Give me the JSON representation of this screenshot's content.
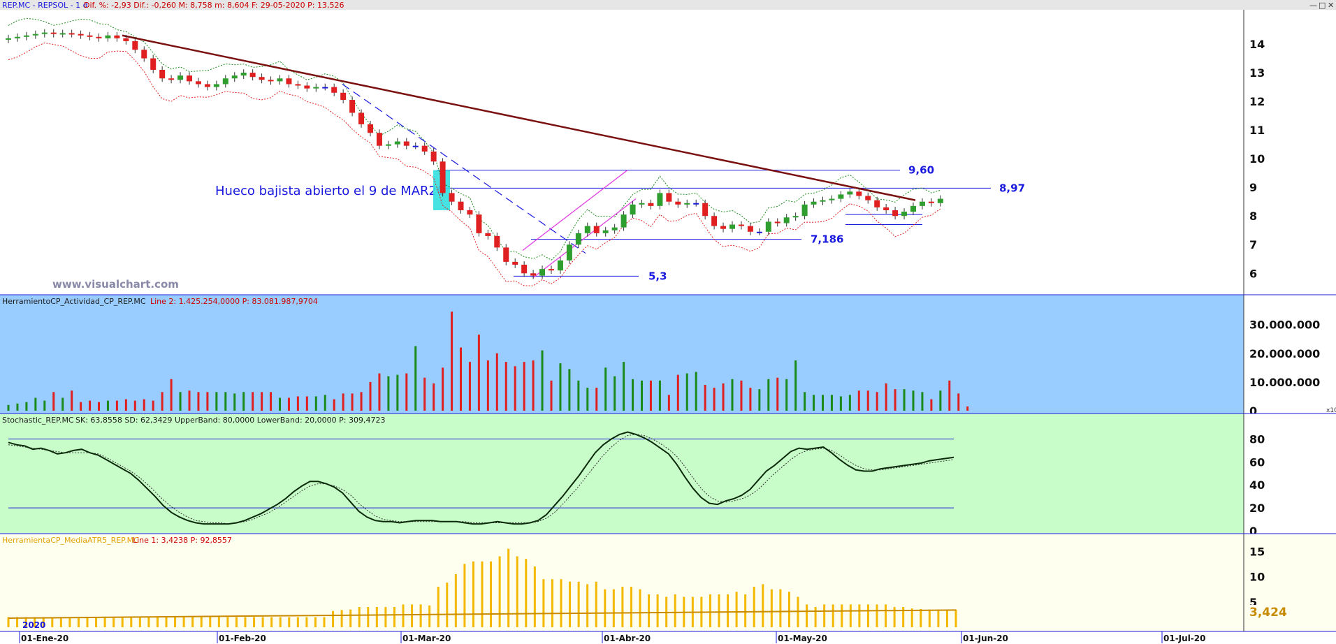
{
  "panels": [
    {
      "id": "price",
      "header": {
        "name": "REP.MC - REPSOL - 1 d",
        "values": "Dif. %: -2,93  Dif.: -0,260  M: 8,758  m: 8,604  F: 29-05-2020  P: 13,526"
      },
      "ylim": [
        5.3,
        15.0
      ],
      "ticks": [
        "14",
        "13",
        "12",
        "11",
        "10",
        "9",
        "8",
        "7",
        "6"
      ],
      "annotation": "Hueco bajista abierto el 9 de MAR20",
      "watermark": "www.visualchart.com",
      "levels": [
        {
          "label": "9,60",
          "value": 9.6
        },
        {
          "label": "8,97",
          "value": 8.97
        },
        {
          "label": "7,186",
          "value": 7.186
        },
        {
          "label": "5,3",
          "value": 5.9
        }
      ]
    },
    {
      "id": "volume",
      "header": {
        "name": "HerramientoCP_Actividad_CP_REP.MC",
        "values": "Line 2: 1.425.254,0000  P: 83.081.987,9704"
      },
      "ticks": [
        "30.000.000",
        "20.000.000",
        "10.000.000",
        "0"
      ],
      "scale_badge": "x10"
    },
    {
      "id": "stochastic",
      "header": {
        "name": "Stochastic_REP.MC",
        "values": "SK: 63,8558  SD: 62,3429  UpperBand: 80,0000  LowerBand: 20,0000  P: 309,4723"
      },
      "ticks": [
        "80",
        "60",
        "40",
        "20",
        "0"
      ]
    },
    {
      "id": "atr",
      "header": {
        "name": "HerramientaCP_MediaATR5_REP.MC",
        "values": "Line 1: 3,4238  P: 92,8557"
      },
      "ticks": [
        "15",
        "10",
        "5"
      ],
      "last_value": "3,424",
      "year_label": "2020"
    }
  ],
  "x_axis": {
    "labels": [
      "01-Ene-20",
      "01-Feb-20",
      "01-Mar-20",
      "01-Abr-20",
      "01-May-20",
      "01-Jun-20",
      "01-Jul-20"
    ]
  },
  "colors": {
    "up": "#2e9e2e",
    "down": "#e02020",
    "neutral": "#1a1adf",
    "trend": "#7a1010",
    "band_hi": "#1a8a1a",
    "band_lo": "#e02020",
    "volume_bg": "#99ccff",
    "stoch_bg": "#c8fcc8",
    "atr_bg": "#fffff0",
    "atr_bar": "#f5b800"
  },
  "chart_data": [
    {
      "type": "candlestick",
      "title": "REP.MC - REPSOL - 1 d",
      "ylim": [
        5.3,
        15.0
      ],
      "dates": [
        "02-Ene",
        "03-Ene",
        "06-Ene",
        "07-Ene",
        "08-Ene",
        "09-Ene",
        "10-Ene",
        "13-Ene",
        "14-Ene",
        "15-Ene",
        "16-Ene",
        "17-Ene",
        "20-Ene",
        "21-Ene",
        "22-Ene",
        "23-Ene",
        "24-Ene",
        "27-Ene",
        "28-Ene",
        "29-Ene",
        "30-Ene",
        "31-Ene",
        "03-Feb",
        "04-Feb",
        "05-Feb",
        "06-Feb",
        "07-Feb",
        "10-Feb",
        "11-Feb",
        "12-Feb",
        "13-Feb",
        "14-Feb",
        "17-Feb",
        "18-Feb",
        "19-Feb",
        "20-Feb",
        "21-Feb",
        "24-Feb",
        "25-Feb",
        "26-Feb",
        "27-Feb",
        "28-Feb",
        "02-Mar",
        "03-Mar",
        "04-Mar",
        "05-Mar",
        "06-Mar",
        "09-Mar",
        "10-Mar",
        "11-Mar",
        "12-Mar",
        "13-Mar",
        "16-Mar",
        "17-Mar",
        "18-Mar",
        "19-Mar",
        "20-Mar",
        "23-Mar",
        "24-Mar",
        "25-Mar",
        "26-Mar",
        "27-Mar",
        "30-Mar",
        "31-Mar",
        "01-Abr",
        "02-Abr",
        "03-Abr",
        "06-Abr",
        "07-Abr",
        "08-Abr",
        "09-Abr",
        "14-Abr",
        "15-Abr",
        "16-Abr",
        "17-Abr",
        "20-Abr",
        "21-Abr",
        "22-Abr",
        "23-Abr",
        "24-Abr",
        "27-Abr",
        "28-Abr",
        "29-Abr",
        "30-Abr",
        "04-May",
        "05-May",
        "06-May",
        "07-May",
        "08-May",
        "11-May",
        "12-May",
        "13-May",
        "14-May",
        "15-May",
        "18-May",
        "19-May",
        "20-May",
        "21-May",
        "22-May",
        "25-May",
        "26-May",
        "27-May",
        "28-May",
        "29-May"
      ],
      "close": [
        14.2,
        14.25,
        14.3,
        14.35,
        14.4,
        14.35,
        14.38,
        14.35,
        14.3,
        14.25,
        14.2,
        14.3,
        14.2,
        14.1,
        13.8,
        13.5,
        13.1,
        12.8,
        12.75,
        12.9,
        12.7,
        12.6,
        12.5,
        12.6,
        12.8,
        12.9,
        13.0,
        12.85,
        12.75,
        12.7,
        12.8,
        12.6,
        12.55,
        12.45,
        12.5,
        12.5,
        12.3,
        12.05,
        11.6,
        11.2,
        10.9,
        10.45,
        10.5,
        10.6,
        10.45,
        10.45,
        10.25,
        9.9,
        8.8,
        8.5,
        8.2,
        8.05,
        7.4,
        7.3,
        6.9,
        6.4,
        6.3,
        6.0,
        5.92,
        6.15,
        6.1,
        6.45,
        7.0,
        7.4,
        7.65,
        7.4,
        7.5,
        7.6,
        8.05,
        8.4,
        8.45,
        8.35,
        8.8,
        8.5,
        8.4,
        8.45,
        8.45,
        8.0,
        7.65,
        7.55,
        7.7,
        7.65,
        7.45,
        7.45,
        7.8,
        7.75,
        7.95,
        8.0,
        8.4,
        8.5,
        8.55,
        8.6,
        8.75,
        8.85,
        8.7,
        8.55,
        8.3,
        8.2,
        8.0,
        8.15,
        8.35,
        8.5,
        8.45,
        8.6
      ],
      "volume": [
        2.0,
        2.5,
        3.0,
        4.5,
        3.5,
        6.5,
        4.5,
        7.0,
        3.0,
        3.5,
        3.0,
        3.5,
        3.5,
        4.0,
        3.5,
        4.0,
        3.5,
        6.5,
        11.0,
        6.5,
        7.0,
        6.5,
        6.5,
        6.5,
        6.5,
        6.0,
        6.5,
        6.5,
        6.5,
        6.5,
        4.5,
        4.5,
        5.0,
        5.0,
        5.0,
        5.5,
        4.0,
        6.0,
        6.0,
        6.5,
        10.0,
        13.0,
        12.0,
        12.5,
        13.0,
        22.5,
        11.5,
        9.5,
        15.0,
        34.5,
        22.0,
        17.0,
        26.5,
        17.5,
        20.0,
        17.0,
        15.5,
        17.0,
        17.5,
        21.0,
        10.5,
        16.5,
        14.5,
        10.5,
        8.0,
        8.0,
        15.0,
        12.0,
        17.0,
        11.0,
        10.5,
        10.5,
        10.5,
        5.5,
        12.5,
        13.0,
        13.5,
        9.0,
        8.0,
        9.5,
        11.0,
        10.5,
        8.0,
        7.5,
        11.0,
        11.5,
        11.0,
        17.5,
        6.5,
        5.5,
        5.5,
        5.5,
        5.0,
        5.5,
        7.0,
        7.0,
        6.5,
        9.5,
        7.5,
        7.5,
        7.0,
        6.5,
        4.0,
        7.0,
        10.5,
        6.0,
        1.5
      ],
      "stoch_sk": [
        77,
        75,
        74,
        71,
        72,
        70,
        67,
        68,
        70,
        71,
        68,
        66,
        62,
        58,
        54,
        50,
        44,
        37,
        30,
        22,
        16,
        12,
        9,
        7,
        6,
        6,
        6,
        6,
        7,
        9,
        12,
        15,
        19,
        23,
        28,
        34,
        39,
        43,
        43,
        41,
        38,
        33,
        25,
        17,
        12,
        9,
        8,
        8,
        7,
        8,
        9,
        9,
        9,
        8,
        8,
        8,
        7,
        6,
        6,
        7,
        8,
        7,
        6,
        6,
        7,
        9,
        14,
        22,
        30,
        39,
        48,
        58,
        68,
        75,
        80,
        84,
        86,
        84,
        81,
        77,
        72,
        67,
        58,
        47,
        37,
        29,
        24,
        23,
        26,
        28,
        31,
        36,
        44,
        52,
        57,
        63,
        69,
        72,
        71,
        72,
        73,
        68,
        62,
        57,
        53,
        52,
        52,
        54,
        55,
        56,
        57,
        58,
        59,
        61,
        62,
        63,
        64
      ],
      "stoch_sd": [
        75,
        74,
        73,
        72,
        71,
        70,
        69,
        68,
        68,
        68,
        68,
        67,
        64,
        60,
        56,
        52,
        47,
        41,
        34,
        27,
        21,
        16,
        12,
        9,
        8,
        7,
        7,
        6,
        7,
        8,
        10,
        13,
        16,
        20,
        25,
        30,
        35,
        39,
        41,
        41,
        39,
        36,
        31,
        24,
        18,
        13,
        10,
        9,
        8,
        8,
        8,
        8,
        8,
        8,
        8,
        8,
        8,
        7,
        7,
        7,
        7,
        7,
        7,
        7,
        7,
        8,
        11,
        16,
        23,
        31,
        39,
        48,
        57,
        66,
        73,
        79,
        83,
        84,
        83,
        80,
        76,
        71,
        65,
        56,
        46,
        37,
        30,
        26,
        25,
        26,
        28,
        31,
        36,
        43,
        50,
        56,
        62,
        67,
        70,
        71,
        72,
        70,
        66,
        61,
        57,
        54,
        53,
        53,
        54,
        55,
        56,
        57,
        58,
        59,
        60,
        61,
        62
      ],
      "atr": [
        2.0,
        2.0,
        2.0,
        2.0,
        2.0,
        2.0,
        2.0,
        2.0,
        2.0,
        2.0,
        2.0,
        2.0,
        2.0,
        2.0,
        2.0,
        2.0,
        2.0,
        2.0,
        2.0,
        2.0,
        2.0,
        2.0,
        2.0,
        2.0,
        2.0,
        2.0,
        2.0,
        2.0,
        2.0,
        2.0,
        2.0,
        2.0,
        2.0,
        2.0,
        2.0,
        2.0,
        2.0,
        3.2,
        3.4,
        3.5,
        4.0,
        4.0,
        4.0,
        4.0,
        4.0,
        4.5,
        4.5,
        4.5,
        4.3,
        8.0,
        8.8,
        10.5,
        12.5,
        13.0,
        13.0,
        13.0,
        14.0,
        15.5,
        14.0,
        13.5,
        12.0,
        9.5,
        9.5,
        9.5,
        9.0,
        9.0,
        8.5,
        9.0,
        7.5,
        7.5,
        8.0,
        8.0,
        7.5,
        6.5,
        6.5,
        6.0,
        6.5,
        6.0,
        6.0,
        6.0,
        6.5,
        6.5,
        6.5,
        7.0,
        6.5,
        8.0,
        8.5,
        7.5,
        7.5,
        7.0,
        6.0,
        4.5,
        4.0,
        4.5,
        4.5,
        4.5,
        4.5,
        4.5,
        4.5,
        4.5,
        4.5,
        4.0,
        4.0,
        3.7,
        3.6,
        3.5,
        3.5,
        3.5,
        3.5
      ],
      "atr_ylim": [
        0,
        16
      ]
    }
  ]
}
